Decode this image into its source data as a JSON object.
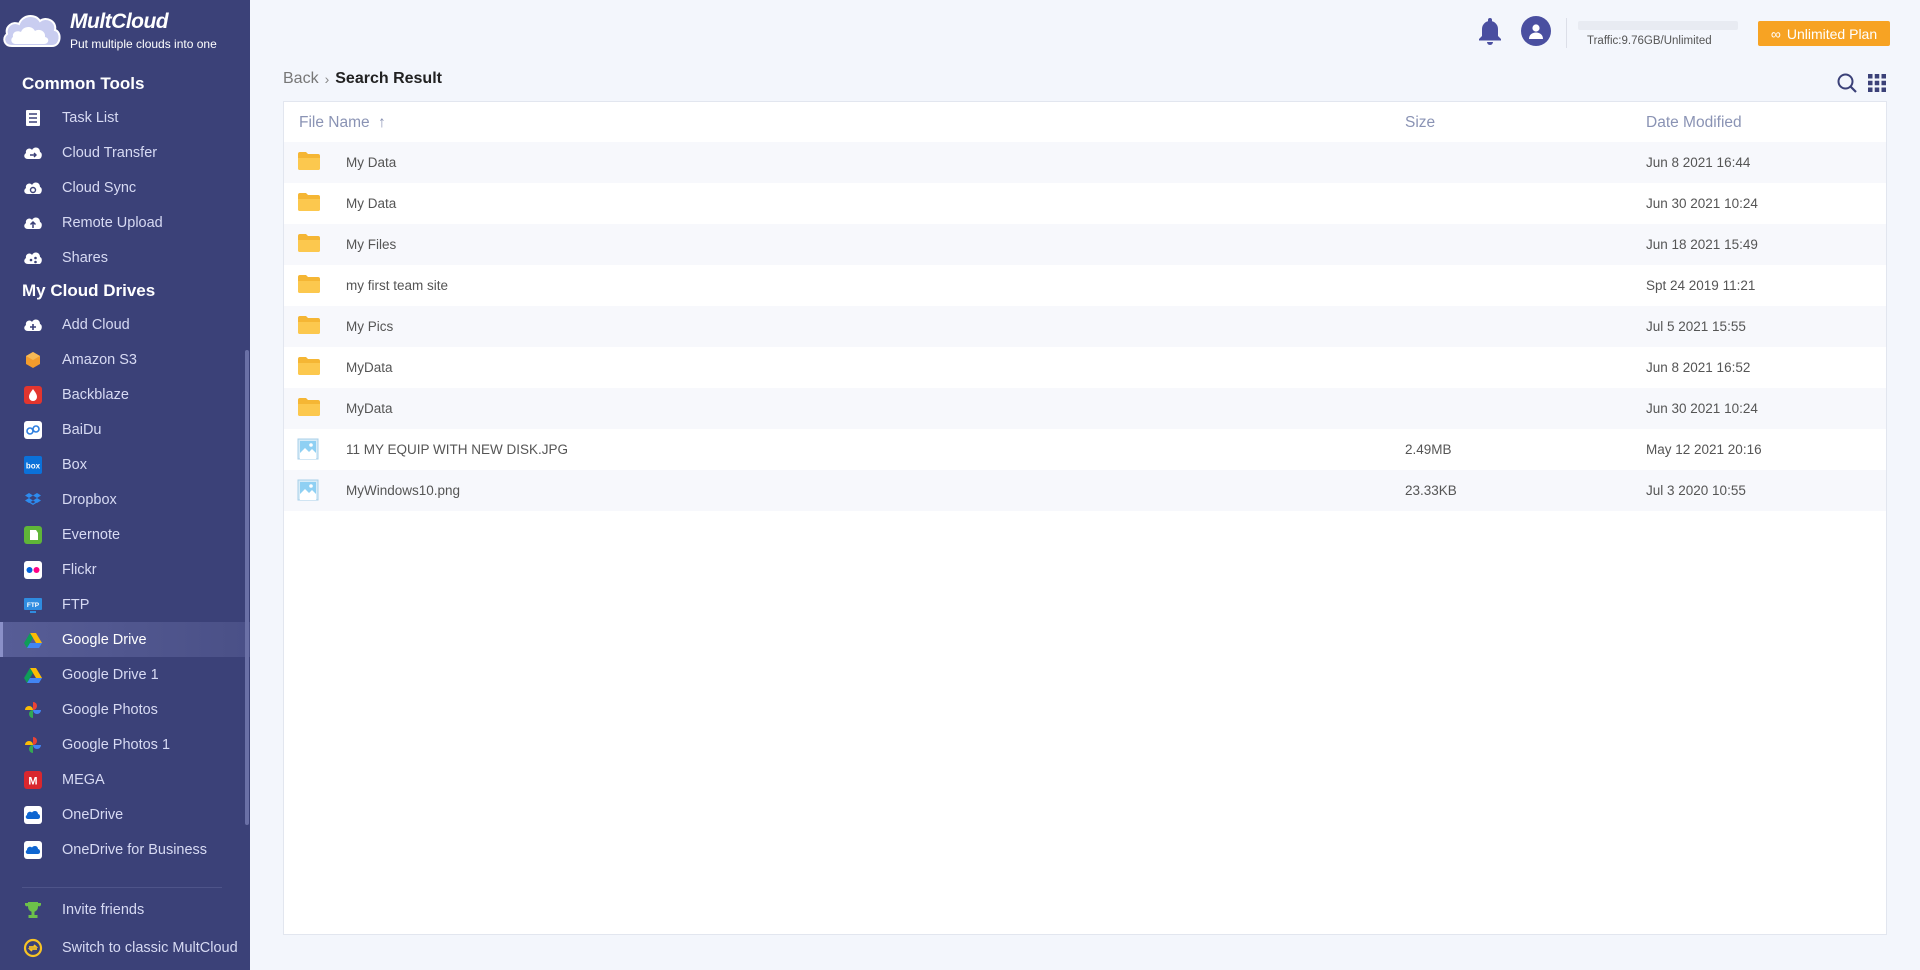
{
  "app": {
    "name": "MultCloud",
    "tagline": "Put multiple clouds into one"
  },
  "sidebar": {
    "common_tools_title": "Common Tools",
    "common_tools": [
      {
        "label": "Task List",
        "icon": "task-list-icon"
      },
      {
        "label": "Cloud Transfer",
        "icon": "cloud-transfer-icon"
      },
      {
        "label": "Cloud Sync",
        "icon": "cloud-sync-icon"
      },
      {
        "label": "Remote Upload",
        "icon": "remote-upload-icon"
      },
      {
        "label": "Shares",
        "icon": "shares-icon"
      }
    ],
    "my_drives_title": "My Cloud Drives",
    "drives": [
      {
        "label": "Add Cloud",
        "icon": "add-cloud-icon"
      },
      {
        "label": "Amazon S3",
        "icon": "amazon-s3-icon"
      },
      {
        "label": "Backblaze",
        "icon": "backblaze-icon"
      },
      {
        "label": "BaiDu",
        "icon": "baidu-icon"
      },
      {
        "label": "Box",
        "icon": "box-icon"
      },
      {
        "label": "Dropbox",
        "icon": "dropbox-icon"
      },
      {
        "label": "Evernote",
        "icon": "evernote-icon"
      },
      {
        "label": "Flickr",
        "icon": "flickr-icon"
      },
      {
        "label": "FTP",
        "icon": "ftp-icon"
      },
      {
        "label": "Google Drive",
        "icon": "google-drive-icon",
        "active": true
      },
      {
        "label": "Google Drive 1",
        "icon": "google-drive-icon"
      },
      {
        "label": "Google Photos",
        "icon": "google-photos-icon"
      },
      {
        "label": "Google Photos 1",
        "icon": "google-photos-icon"
      },
      {
        "label": "MEGA",
        "icon": "mega-icon"
      },
      {
        "label": "OneDrive",
        "icon": "onedrive-icon"
      },
      {
        "label": "OneDrive for Business",
        "icon": "onedrive-icon"
      }
    ],
    "invite_label": "Invite friends",
    "switch_label": "Switch to classic MultCloud"
  },
  "topbar": {
    "traffic": "Traffic:9.76GB/Unlimited",
    "plan_label": "Unlimited Plan"
  },
  "breadcrumb": {
    "back": "Back",
    "current": "Search Result"
  },
  "table": {
    "columns": {
      "name": "File Name",
      "size": "Size",
      "date": "Date Modified"
    },
    "rows": [
      {
        "type": "folder",
        "name": "My Data",
        "size": "",
        "date": "Jun 8 2021 16:44"
      },
      {
        "type": "folder",
        "name": "My Data",
        "size": "",
        "date": "Jun 30 2021 10:24"
      },
      {
        "type": "folder",
        "name": "My Files",
        "size": "",
        "date": "Jun 18 2021 15:49"
      },
      {
        "type": "folder",
        "name": "my first team site",
        "size": "",
        "date": "Spt 24 2019 11:21"
      },
      {
        "type": "folder",
        "name": "My Pics",
        "size": "",
        "date": "Jul 5 2021 15:55"
      },
      {
        "type": "folder",
        "name": "MyData",
        "size": "",
        "date": "Jun 8 2021 16:52"
      },
      {
        "type": "folder",
        "name": "MyData",
        "size": "",
        "date": "Jun 30 2021 10:24"
      },
      {
        "type": "image",
        "name": "11 MY EQUIP WITH NEW DISK.JPG",
        "size": "2.49MB",
        "date": "May 12 2021 20:16"
      },
      {
        "type": "image",
        "name": "MyWindows10.png",
        "size": "23.33KB",
        "date": "Jul 3 2020 10:55"
      }
    ]
  },
  "colors": {
    "sidebar_bg": "#3b4178",
    "accent_orange": "#f7a323",
    "folder_yellow": "#fcc84e"
  }
}
